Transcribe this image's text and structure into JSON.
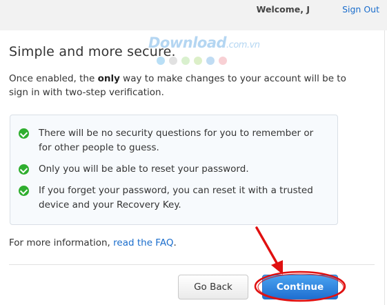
{
  "header": {
    "welcome_text": "Welcome, J",
    "signout_label": "Sign Out"
  },
  "watermark": {
    "text": "Download",
    "suffix": ".com.vn",
    "dot_colors": [
      "#7fc4ee",
      "#c9c9c9",
      "#b9e3a5",
      "#bfe29a",
      "#8cc0ea",
      "#f3a9b0"
    ]
  },
  "main": {
    "title": "Simple and more secure.",
    "intro_before": "Once enabled, the ",
    "intro_bold": "only",
    "intro_after": " way to make changes to your account will be to sign in with two-step verification.",
    "benefits": [
      "There will be no security questions for you to remember or for other people to guess.",
      "Only you will be able to reset your password.",
      "If you forget your password, you can reset it with a trusted device and your Recovery Key."
    ],
    "more_info_text": "For more information, ",
    "faq_link": "read the FAQ",
    "more_info_end": "."
  },
  "buttons": {
    "back_label": "Go Back",
    "continue_label": "Continue"
  },
  "colors": {
    "link": "#1a6dcc",
    "check": "#2fae2f",
    "primary_button": "#1f6fd1",
    "annotation": "#e01010"
  }
}
